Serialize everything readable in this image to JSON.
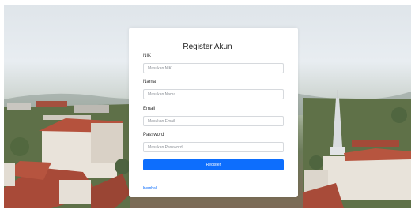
{
  "register": {
    "title": "Register Akun",
    "nik_label": "NIK",
    "nik_placeholder": "Masukan NIK",
    "nama_label": "Nama",
    "nama_placeholder": "Masukan Nama",
    "email_label": "Email",
    "email_placeholder": "Masukan Email",
    "password_label": "Password",
    "password_placeholder": "Masukan Password",
    "submit_label": "Register",
    "back_link": "Kembali"
  }
}
